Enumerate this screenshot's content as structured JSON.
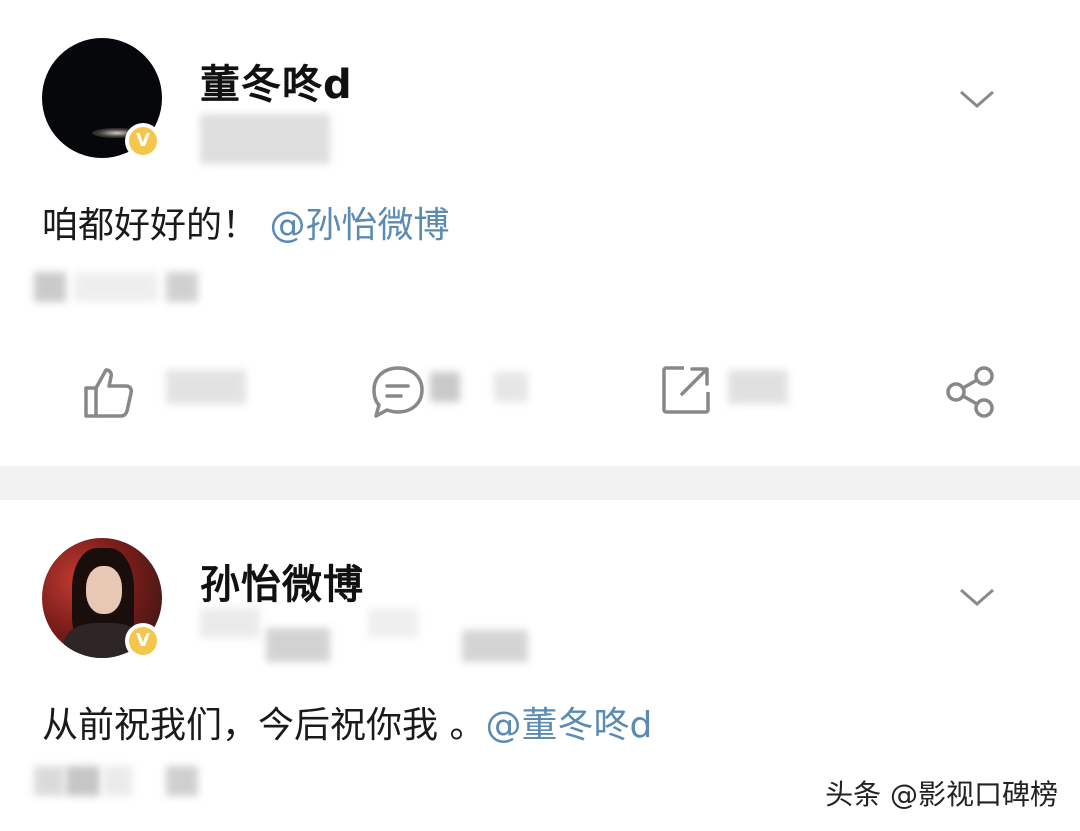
{
  "posts": [
    {
      "username": "董冬咚d",
      "verified_badge": "V",
      "text": "咱都好好的！",
      "mention": "@孙怡微博",
      "avatar_icon": "dark-avatar",
      "actions": {
        "like_icon": "thumbs-up-icon",
        "comment_icon": "comment-icon",
        "repost_icon": "repost-icon",
        "share_icon": "share-icon"
      }
    },
    {
      "username": "孙怡微博",
      "verified_badge": "V",
      "text": "从前祝我们，今后祝你我 。",
      "mention": "@董冬咚d",
      "avatar_icon": "portrait-avatar"
    }
  ],
  "watermark": "头条 @影视口碑榜",
  "colors": {
    "mention": "#5b8bb3",
    "badge": "#f4c64c",
    "icon_gray": "#888888",
    "separator": "#f2f2f2"
  }
}
